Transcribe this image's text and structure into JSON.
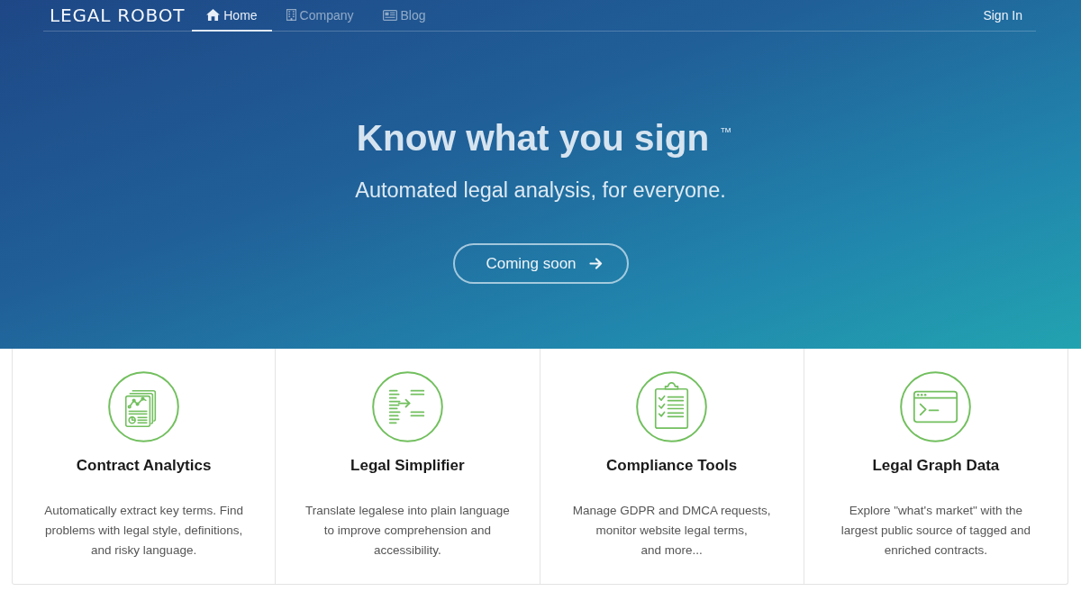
{
  "nav": {
    "logo": "LEGAL ROBOT",
    "items": [
      {
        "label": "Home",
        "kind": "home",
        "selected": true
      },
      {
        "label": "Company",
        "kind": "company",
        "selected": false
      },
      {
        "label": "Blog",
        "kind": "blog",
        "selected": false
      }
    ],
    "sign_in": "Sign In"
  },
  "hero": {
    "title": "Know what you sign",
    "trademark": "™",
    "subtitle": "Automated legal analysis, for everyone.",
    "button": "Coming soon"
  },
  "features": [
    {
      "kind": "analytics",
      "title": "Contract Analytics",
      "description": [
        "Automatically extract key terms. Find",
        "problems with legal style, definitions,",
        "and risky language."
      ]
    },
    {
      "kind": "simplifier",
      "title": "Legal Simplifier",
      "description": [
        "Translate legalese into plain language",
        "to improve comprehension and",
        "accessibility."
      ]
    },
    {
      "kind": "compliance",
      "title": "Compliance Tools",
      "description": [
        "Manage GDPR and DMCA requests,",
        "monitor website legal terms,",
        "and more..."
      ]
    },
    {
      "kind": "graph",
      "title": "Legal Graph Data",
      "description": [
        "Explore \"what's market\" with the",
        "largest public source of tagged and",
        "enriched contracts."
      ]
    }
  ]
}
